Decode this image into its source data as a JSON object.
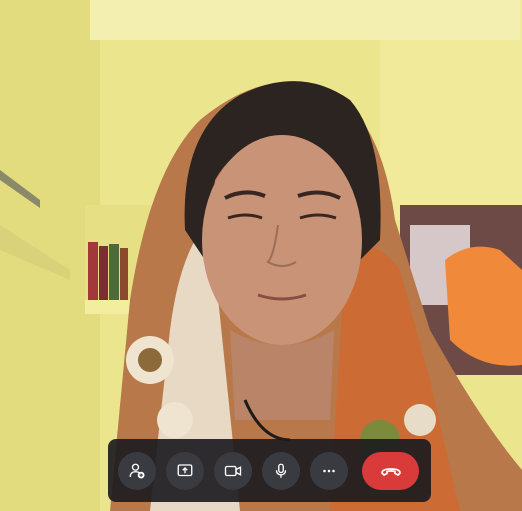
{
  "call": {
    "controls": [
      {
        "name": "add-participant-button",
        "icon": "add-person-icon"
      },
      {
        "name": "share-screen-button",
        "icon": "share-screen-icon"
      },
      {
        "name": "camera-button",
        "icon": "video-camera-icon"
      },
      {
        "name": "microphone-button",
        "icon": "microphone-icon"
      },
      {
        "name": "more-options-button",
        "icon": "more-horizontal-icon"
      }
    ],
    "end_call": {
      "icon": "end-call-icon",
      "color": "#d93a3a"
    }
  },
  "colors": {
    "toolbar_bg": "#1c1c20",
    "button_bg": "#3a3b40",
    "icon_color": "#ffffff",
    "wall": "#e9e48a"
  }
}
